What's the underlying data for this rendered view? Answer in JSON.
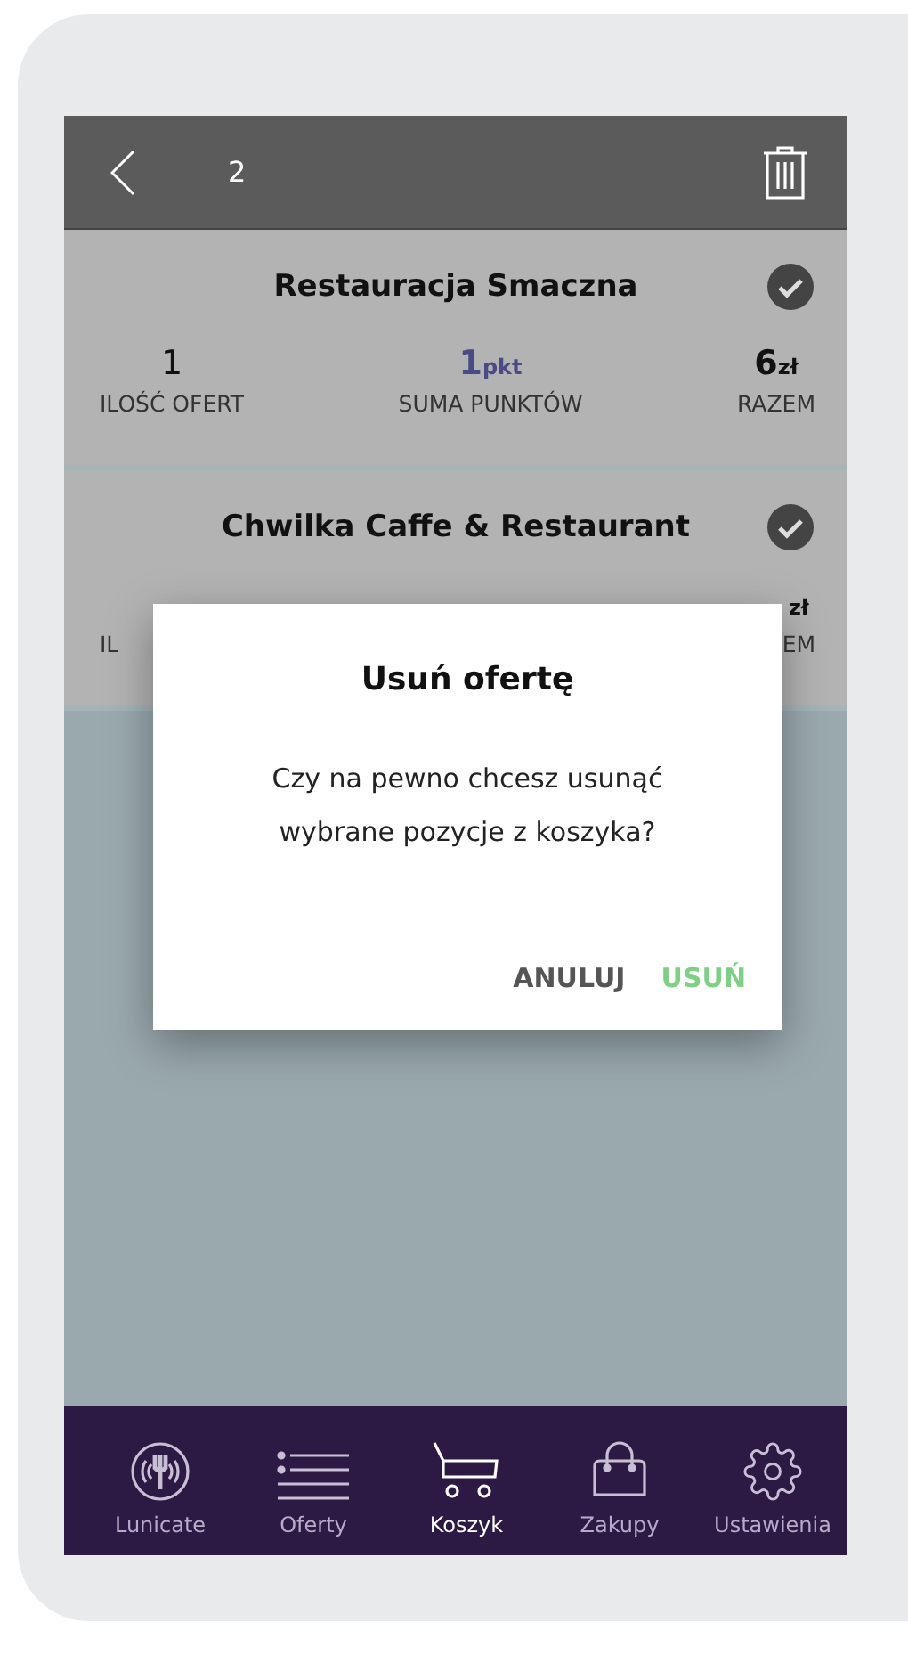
{
  "header": {
    "count": "2"
  },
  "cards": [
    {
      "name": "Restauracja Smaczna",
      "checked": true,
      "stats": [
        {
          "value": "1",
          "label": "ILOŚĆ OFERT",
          "kind": "plain"
        },
        {
          "value": "1",
          "unit": "pkt",
          "label": "SUMA PUNKTÓW",
          "kind": "points"
        },
        {
          "value": "6",
          "unit": "zł",
          "label": "RAZEM",
          "kind": "money"
        }
      ]
    },
    {
      "name": "Chwilka Caffe & Restaurant",
      "checked": true,
      "stats": [
        {
          "label": "IL",
          "kind": "plain"
        },
        {
          "unit": "zł",
          "label": "EM",
          "kind": "money"
        }
      ]
    }
  ],
  "dialog": {
    "title": "Usuń ofertę",
    "message": "Czy na pewno chcesz usunąć wybrane pozycje z koszyka?",
    "buttons": [
      {
        "label": "ANULUJ",
        "kind": "cancel"
      },
      {
        "label": "USUŃ",
        "kind": "confirm"
      }
    ]
  },
  "nav": [
    {
      "label": "Lunicate",
      "kind": "logo",
      "selected": false
    },
    {
      "label": "Oferty",
      "kind": "list",
      "selected": false
    },
    {
      "label": "Koszyk",
      "kind": "cart",
      "selected": true
    },
    {
      "label": "Zakupy",
      "kind": "bag",
      "selected": false
    },
    {
      "label": "Ustawienia",
      "kind": "gear",
      "selected": false
    }
  ]
}
